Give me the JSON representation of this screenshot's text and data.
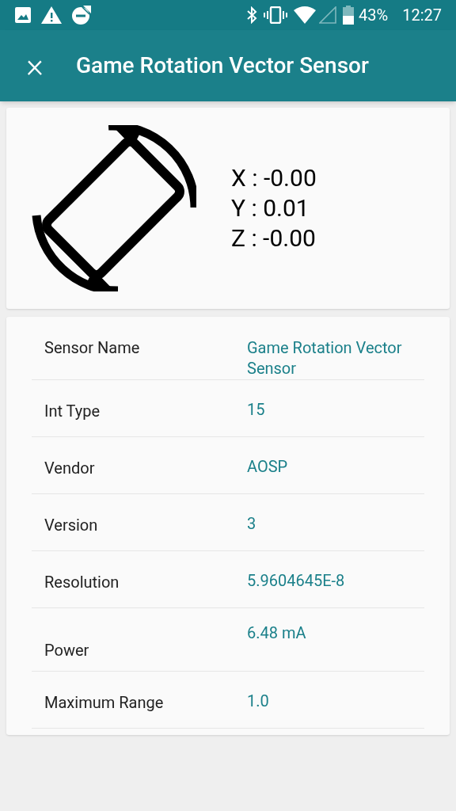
{
  "status_bar": {
    "battery": "43%",
    "time": "12:27"
  },
  "app_bar": {
    "close": "×",
    "title": "Game Rotation Vector Sensor"
  },
  "readings": [
    {
      "label": "X : -0.00"
    },
    {
      "label": "Y : 0.01"
    },
    {
      "label": "Z : -0.00"
    }
  ],
  "details": [
    {
      "name": "Sensor Name",
      "value": "Game Rotation Vector Sensor"
    },
    {
      "name": "Int Type",
      "value": "15"
    },
    {
      "name": "Vendor",
      "value": "AOSP"
    },
    {
      "name": "Version",
      "value": "3"
    },
    {
      "name": "Resolution",
      "value": "5.9604645E-8"
    },
    {
      "name": "Power",
      "value": "6.48 mA"
    },
    {
      "name": "Maximum Range",
      "value": "1.0"
    }
  ]
}
